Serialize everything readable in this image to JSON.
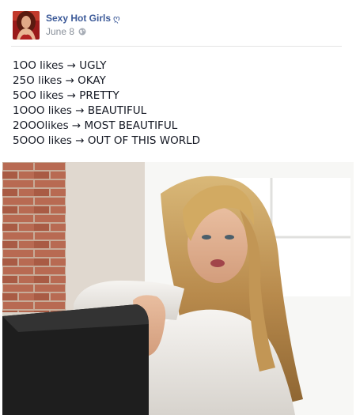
{
  "post": {
    "page_name": "Sexy Hot Girls",
    "verified_mark": "ღ",
    "date": "June 8",
    "privacy_icon": "globe-icon",
    "lines": [
      "1OO likes → UGLY",
      "25O likes → OKAY",
      "5OO likes → PRETTY",
      "1OOO likes → BEAUTIFUL",
      "2OOOlikes → MOST BEAUTIFUL",
      "5OOO likes → OUT OF THIS WORLD"
    ],
    "photo_icon": "photo-woman"
  },
  "colors": {
    "name_link": "#3b5998",
    "meta_text": "#89909a",
    "body_text": "#141823",
    "divider": "#e5e5e5"
  }
}
